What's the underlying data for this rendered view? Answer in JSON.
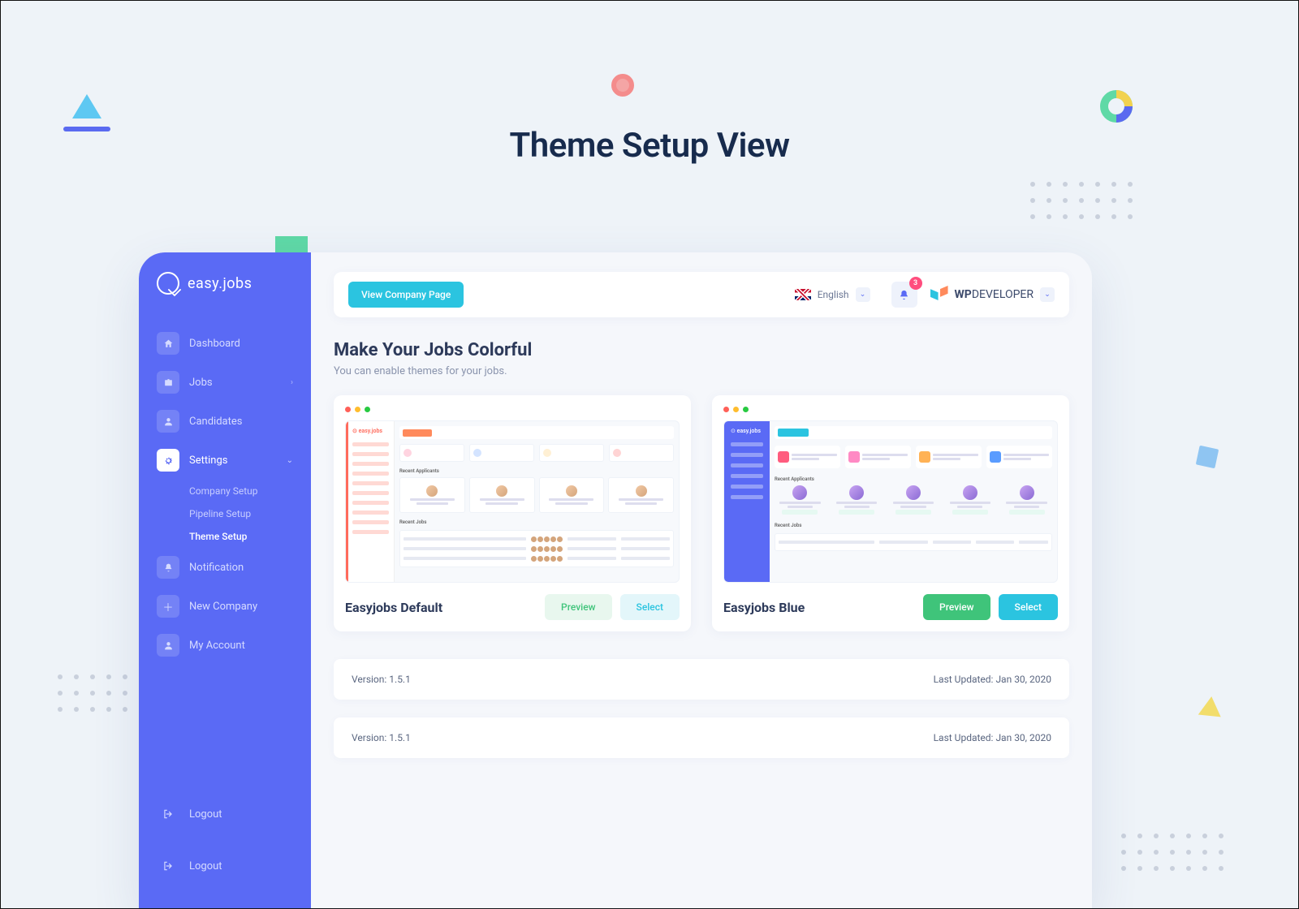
{
  "page_title": "Theme Setup View",
  "logo_text": "easy.jobs",
  "sidebar": {
    "items": [
      {
        "label": "Dashboard",
        "icon": "home"
      },
      {
        "label": "Jobs",
        "icon": "briefcase"
      },
      {
        "label": "Candidates",
        "icon": "user"
      },
      {
        "label": "Settings",
        "icon": "gear"
      },
      {
        "label": "Notification",
        "icon": "bell"
      },
      {
        "label": "New Company",
        "icon": "plus"
      },
      {
        "label": "My Account",
        "icon": "user"
      }
    ],
    "settings_sub": [
      {
        "label": "Company Setup"
      },
      {
        "label": "Pipeline Setup"
      },
      {
        "label": "Theme Setup"
      }
    ],
    "logout": "Logout"
  },
  "topbar": {
    "view_company": "View Company Page",
    "language": "English",
    "notif_count": "3",
    "brand_strong": "WP",
    "brand_rest": "DEVELOPER"
  },
  "section": {
    "title": "Make Your Jobs Colorful",
    "subtitle": "You can enable themes for your jobs."
  },
  "themes": [
    {
      "name": "Easyjobs Default",
      "preview": "Preview",
      "select": "Select"
    },
    {
      "name": "Easyjobs Blue",
      "preview": "Preview",
      "select": "Select"
    }
  ],
  "footer": {
    "version_label": "Version: ",
    "version": "1.5.1",
    "updated_label": "Last Updated: ",
    "updated": "Jan 30, 2020"
  }
}
